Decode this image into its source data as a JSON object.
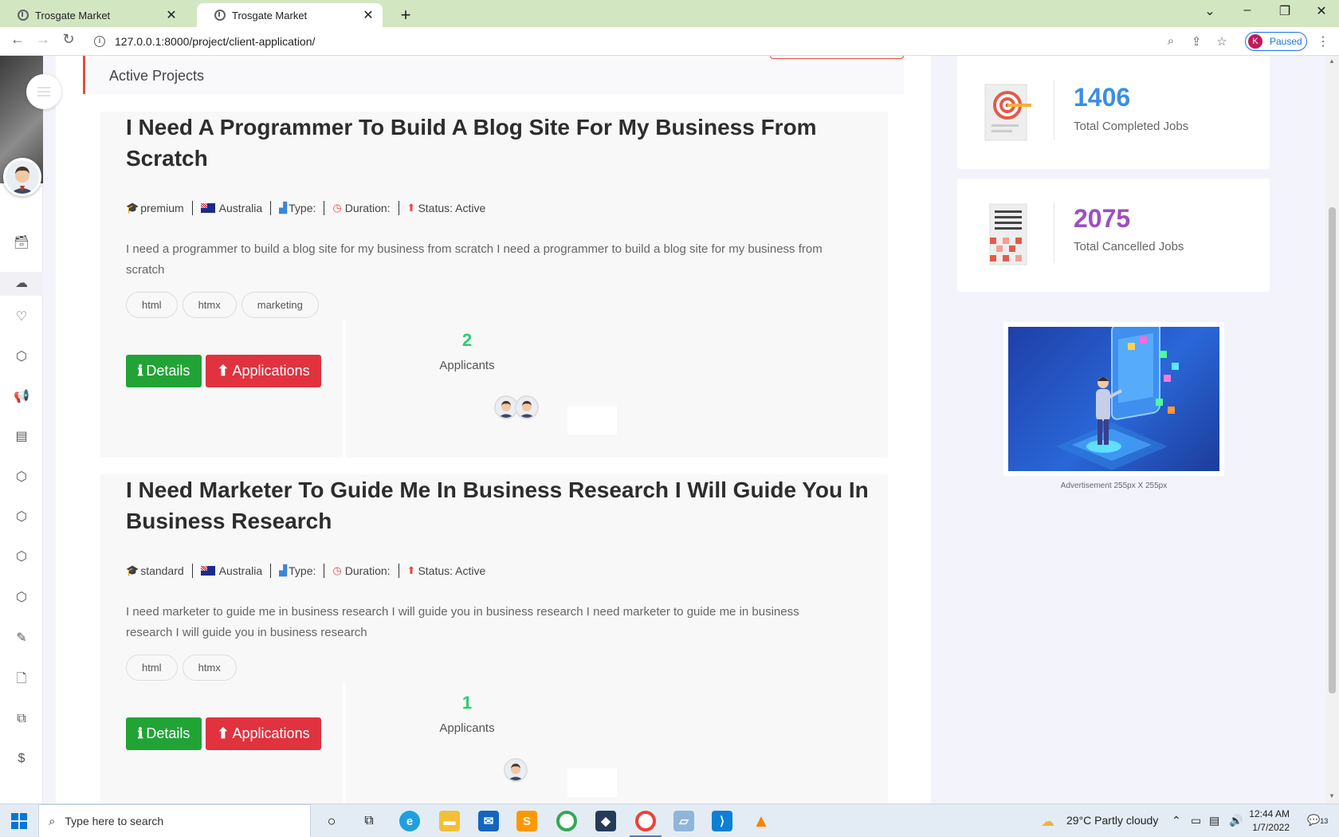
{
  "browser": {
    "tabs": [
      {
        "title": "Trosgate Market",
        "active": false
      },
      {
        "title": "Trosgate Market",
        "active": true
      }
    ],
    "url": "127.0.0.1:8000/project/client-application/",
    "profile_initial": "K",
    "profile_status": "Paused"
  },
  "section": {
    "title": "Active Projects"
  },
  "projects": [
    {
      "title": "I Need A Programmer To Build A Blog Site For My Business From Scratch",
      "package": "premium",
      "country": "Australia",
      "type_label": "Type:",
      "duration_label": "Duration:",
      "status": "Status: Active",
      "description": "I need a programmer to build a blog site for my business from scratch I need a programmer to build a blog site for my business from scratch",
      "tags": [
        "html",
        "htmx",
        "marketing"
      ],
      "details_label": "Details",
      "applications_label": "Applications",
      "applicant_count": "2",
      "applicants_label": "Applicants"
    },
    {
      "title": "I Need Marketer To Guide Me In Business Research I Will Guide You In Business Research",
      "package": "standard",
      "country": "Australia",
      "type_label": "Type:",
      "duration_label": "Duration:",
      "status": "Status: Active",
      "description": "I need marketer to guide me in business research I will guide you in business research I need marketer to guide me in business research I will guide you in business research",
      "tags": [
        "html",
        "htmx"
      ],
      "details_label": "Details",
      "applications_label": "Applications",
      "applicant_count": "1",
      "applicants_label": "Applicants"
    }
  ],
  "stats": [
    {
      "value": "1406",
      "label": "Total Completed Jobs",
      "color": "#3a8ee6"
    },
    {
      "value": "2075",
      "label": "Total Cancelled Jobs",
      "color": "#9b4fc0"
    }
  ],
  "ad": {
    "caption": "Advertisement 255px X 255px"
  },
  "taskbar": {
    "search_placeholder": "Type here to search",
    "weather": "29°C  Partly cloudy",
    "time": "12:44 AM",
    "date": "1/7/2022",
    "notifications": "13"
  }
}
